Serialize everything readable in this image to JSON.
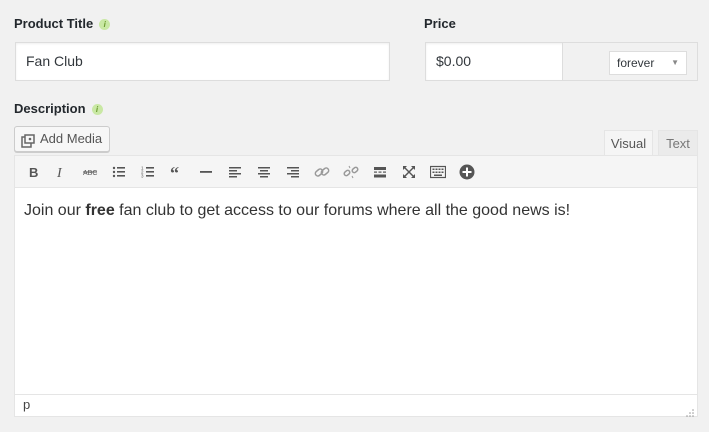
{
  "product_title": {
    "label": "Product Title",
    "value": "Fan Club"
  },
  "price": {
    "label": "Price",
    "value": "$0.00",
    "period_selected": "forever"
  },
  "description": {
    "label": "Description",
    "add_media_label": "Add Media",
    "tabs": [
      {
        "label": "Visual",
        "active": true
      },
      {
        "label": "Text",
        "active": false
      }
    ],
    "toolbar_icons": [
      "bold-icon",
      "italic-icon",
      "strikethrough-icon",
      "bulleted-list-icon",
      "numbered-list-icon",
      "blockquote-icon",
      "horizontal-line-icon",
      "align-left-icon",
      "align-center-icon",
      "align-right-icon",
      "insert-link-icon",
      "remove-link-icon",
      "read-more-icon",
      "fullscreen-icon",
      "toolbar-toggle-icon",
      "add-icon"
    ],
    "content": {
      "before": "Join our ",
      "bold": "free",
      "after": " fan club to get access to our forums where all the good news is!"
    },
    "status_path": "p"
  },
  "colors": {
    "background": "#f1f1f1",
    "info_dot": "#c9e8a4"
  }
}
